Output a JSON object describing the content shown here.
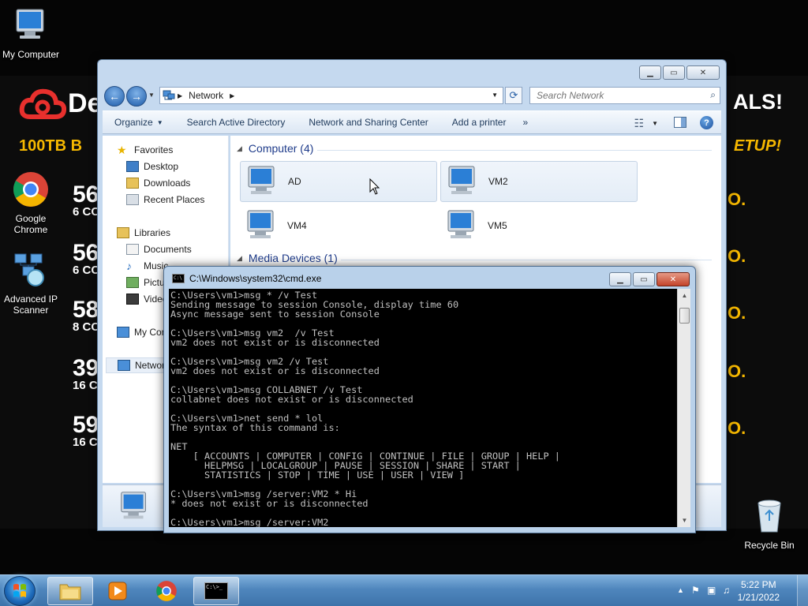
{
  "desktop": {
    "icons": {
      "my_computer": "My Computer",
      "chrome": "Google Chrome",
      "ip_scanner": "Advanced IP Scanner",
      "recycle_bin": "Recycle Bin"
    },
    "wallpaper": {
      "brand": "De",
      "promo": "ALS!",
      "tagline": "100TB B",
      "tagline_right": "ETUP!",
      "rows": [
        {
          "big": "56",
          "small": "6 CC"
        },
        {
          "big": "56",
          "small": "6 CC"
        },
        {
          "big": "58",
          "small": "8 CC"
        },
        {
          "big": "39",
          "small": "16 C"
        },
        {
          "big": "59",
          "small": "16 C"
        }
      ],
      "dots": [
        "O.",
        "O.",
        "O.",
        "O.",
        "O."
      ]
    }
  },
  "explorer": {
    "address": {
      "crumb": "Network"
    },
    "search": {
      "placeholder": "Search Network"
    },
    "toolbar": {
      "organize": "Organize",
      "search_ad": "Search Active Directory",
      "network_sharing": "Network and Sharing Center",
      "add_printer": "Add a printer",
      "more": "»"
    },
    "nav": {
      "favorites": "Favorites",
      "desktop": "Desktop",
      "downloads": "Downloads",
      "recent": "Recent Places",
      "libraries": "Libraries",
      "documents": "Documents",
      "music": "Music",
      "pictures": "Pictures",
      "videos": "Videos",
      "my_computer": "My Computer",
      "network": "Network"
    },
    "groups": {
      "computer": "Computer (4)",
      "media": "Media Devices (1)"
    },
    "computers": [
      "AD",
      "VM2",
      "VM4",
      "VM5"
    ]
  },
  "cmd": {
    "title": "C:\\Windows\\system32\\cmd.exe",
    "output": "C:\\Users\\vm1>msg * /v Test\nSending message to session Console, display time 60\nAsync message sent to session Console\n\nC:\\Users\\vm1>msg vm2  /v Test\nvm2 does not exist or is disconnected\n\nC:\\Users\\vm1>msg vm2 /v Test\nvm2 does not exist or is disconnected\n\nC:\\Users\\vm1>msg COLLABNET /v Test\ncollabnet does not exist or is disconnected\n\nC:\\Users\\vm1>net send * lol\nThe syntax of this command is:\n\nNET\n    [ ACCOUNTS | COMPUTER | CONFIG | CONTINUE | FILE | GROUP | HELP |\n      HELPMSG | LOCALGROUP | PAUSE | SESSION | SHARE | START |\n      STATISTICS | STOP | TIME | USE | USER | VIEW ]\n\nC:\\Users\\vm1>msg /server:VM2 * Hi\n* does not exist or is disconnected\n\nC:\\Users\\vm1>msg /server:VM2"
  },
  "taskbar": {
    "time": "5:22 PM",
    "date": "1/21/2022",
    "cmd_icon_text": "C:\\>_"
  },
  "colors": {
    "wallpaper_accent": "#f6b800",
    "brand_red": "#e8302d",
    "group_title": "#1e3b8a",
    "close_red": "#c3432a"
  }
}
